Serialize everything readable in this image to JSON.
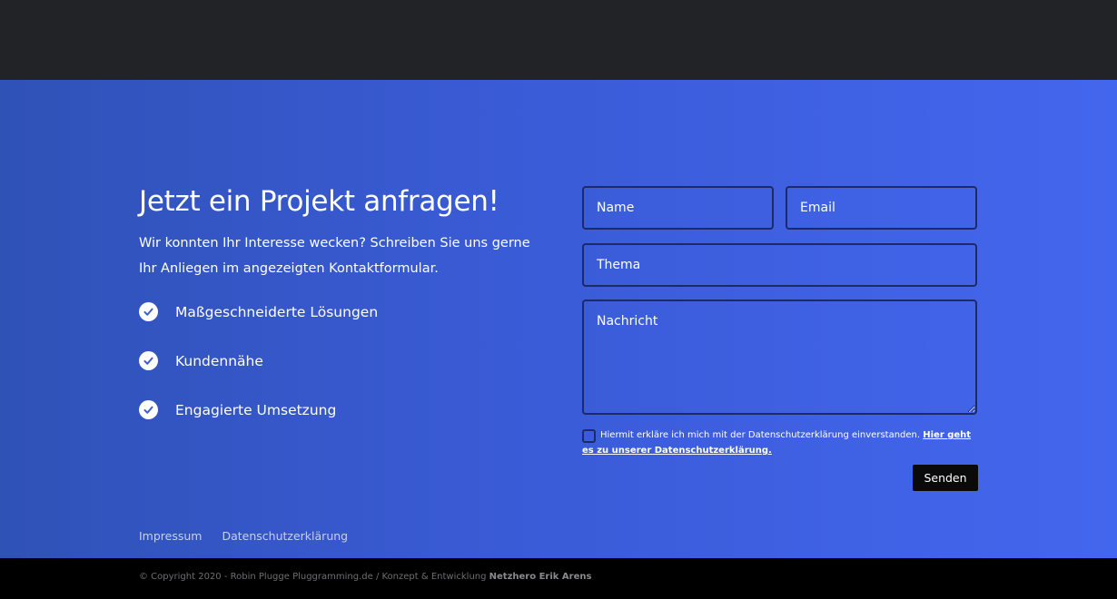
{
  "colors": {
    "top_bar": "#222326",
    "hero_gradient_start": "#2f52b7",
    "hero_gradient_end": "#4366ee",
    "field_border": "#1d2a66",
    "button_bg": "#0a0a0a",
    "bottom_bar": "#000000"
  },
  "hero": {
    "headline": "Jetzt ein Projekt anfragen!",
    "intro": "Wir konnten Ihr Interesse wecken? Schreiben Sie uns gerne Ihr Anliegen im angezeigten Kontaktformular.",
    "features": [
      {
        "label": "Maßgeschneiderte Lösungen",
        "icon": "check-circle-icon"
      },
      {
        "label": "Kundennähe",
        "icon": "check-circle-icon"
      },
      {
        "label": "Engagierte Umsetzung",
        "icon": "check-circle-icon"
      }
    ]
  },
  "form": {
    "name_placeholder": "Name",
    "email_placeholder": "Email",
    "subject_placeholder": "Thema",
    "message_placeholder": "Nachricht",
    "consent_checked": false,
    "consent_text": "Hiermit erkläre ich mich mit der Datenschutzerklärung einverstanden.",
    "consent_link": "Hier geht es zu unserer Datenschutzerklärung.",
    "send_label": "Senden"
  },
  "footer": {
    "links": [
      "Impressum",
      "Datenschutzerklärung"
    ],
    "copyright_prefix": "© Copyright 2020 - Robin Plugge Pluggramming.de / Konzept & Entwicklung",
    "copyright_strong": "Netzhero Erik Arens"
  }
}
